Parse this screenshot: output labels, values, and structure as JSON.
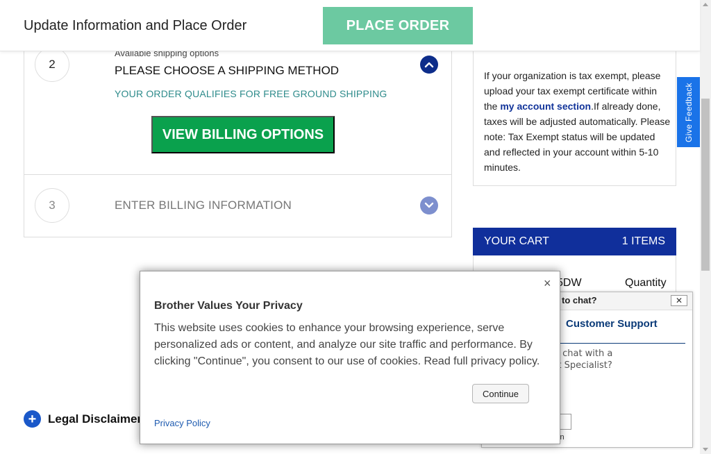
{
  "header": {
    "title": "Update Information and Place Order",
    "place_order_label": "PLACE ORDER"
  },
  "steps": {
    "step2": {
      "number": "2",
      "sub_label": "Available shipping options",
      "title": "PLEASE CHOOSE A SHIPPING METHOD",
      "notice": "YOUR ORDER QUALIFIES FOR FREE GROUND SHIPPING",
      "button_label": "VIEW BILLING OPTIONS"
    },
    "step3": {
      "number": "3",
      "title": "ENTER BILLING INFORMATION"
    }
  },
  "tax": {
    "text_before": "If your organization is tax exempt, please upload your tax exempt certificate within the ",
    "link_label": "my account section",
    "text_after": ".If already done, taxes will be adjusted automatically. Please note: Tax Exempt status will be updated and reflected in your account within 5-10 minutes."
  },
  "feedback": {
    "label": "Give Feedback"
  },
  "cart": {
    "title": "YOUR CART",
    "count": "1 ITEMS",
    "model_fragment": "5DW",
    "quantity_label": "Quantity"
  },
  "chat": {
    "question_fragment": "to chat?",
    "close_label": "✕",
    "title_fragment": "Customer Support",
    "line1_fragment": "o chat with a",
    "line2_fragment": "rt Specialist?",
    "footer_fragment": "in"
  },
  "legal": {
    "label": "Legal Disclaimer"
  },
  "modal": {
    "close_label": "×",
    "title": "Brother Values Your Privacy",
    "body": "This website uses cookies to enhance your browsing experience, serve personalized ads or content, and analyze our site traffic and performance. By clicking \"Continue\", you consent to our use of cookies. Read full privacy policy.",
    "continue_label": "Continue",
    "privacy_link": "Privacy Policy"
  },
  "colors": {
    "place_order_bg": "#6cc9a1",
    "billing_button_bg": "#0aa14d",
    "cart_header_bg": "#102f9b",
    "feedback_bg": "#1a73e8",
    "chevron_active": "#0d2d8a",
    "chevron_inactive": "#7d8fce"
  }
}
